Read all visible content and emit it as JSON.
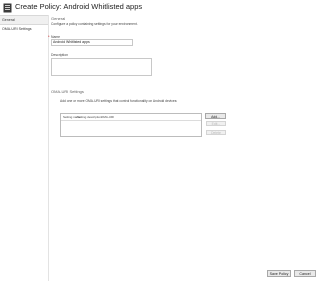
{
  "window": {
    "title": "Create Policy: Android Whitlisted apps"
  },
  "sidebar": {
    "items": [
      {
        "label": "General",
        "active": true
      },
      {
        "label": "OMA-URI Settings",
        "active": false
      }
    ]
  },
  "general": {
    "heading": "General",
    "description": "Configure a policy containing settings for your environment.",
    "name_label": "Name",
    "name_value": "Android Whitlisted apps",
    "description_label": "Description",
    "description_value": ""
  },
  "oma": {
    "heading": "OMA-URI Settings",
    "description": "Add one or more OMA-URI settings that control functionality on Android devices:",
    "columns": [
      "Setting name",
      "Setting description",
      "OMA-URI"
    ],
    "rows": [],
    "add_label": "Add...",
    "edit_label": "Edit...",
    "delete_label": "Delete"
  },
  "footer": {
    "save_label": "Save Policy",
    "cancel_label": "Cancel"
  },
  "colors": {
    "accent": "#1f4e79",
    "disabled_text": "#bbbbbb",
    "required": "#cc0000"
  }
}
